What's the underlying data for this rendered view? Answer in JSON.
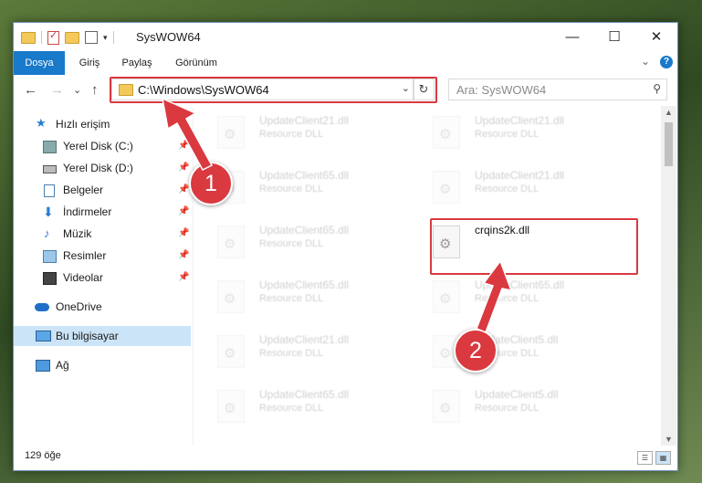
{
  "window": {
    "title": "SysWOW64",
    "controls": {
      "minimize": "—",
      "maximize": "☐",
      "close": "✕"
    }
  },
  "ribbon": {
    "tabs": [
      "Dosya",
      "Giriş",
      "Paylaş",
      "Görünüm"
    ],
    "accent_color": "#1979ca",
    "collapse_glyph": "⌄",
    "help_glyph": "?"
  },
  "navigation": {
    "back": "←",
    "forward": "→",
    "recent": "⌄",
    "up": "↑",
    "address": "C:\\Windows\\SysWOW64",
    "address_dropdown": "⌄",
    "refresh": "↻",
    "search_placeholder": "Ara: SysWOW64",
    "search_glyph": "⚲"
  },
  "sidebar": {
    "items": [
      {
        "label": "Hızlı erişim",
        "icon": "star-icon",
        "pinned": false
      },
      {
        "label": "Yerel Disk (C:)",
        "icon": "drive-icon",
        "pinned": true
      },
      {
        "label": "Yerel Disk (D:)",
        "icon": "drive-icon",
        "pinned": true
      },
      {
        "label": "Belgeler",
        "icon": "documents-icon",
        "pinned": true
      },
      {
        "label": "İndirmeler",
        "icon": "download-icon",
        "pinned": true
      },
      {
        "label": "Müzik",
        "icon": "music-icon",
        "pinned": true
      },
      {
        "label": "Resimler",
        "icon": "pictures-icon",
        "pinned": true
      },
      {
        "label": "Videolar",
        "icon": "videos-icon",
        "pinned": true
      },
      {
        "label": "OneDrive",
        "icon": "cloud-icon",
        "pinned": false
      },
      {
        "label": "Bu bilgisayar",
        "icon": "computer-icon",
        "pinned": false,
        "selected": true
      },
      {
        "label": "Ağ",
        "icon": "network-icon",
        "pinned": false
      }
    ],
    "pin_glyph": "📌"
  },
  "files": [
    {
      "name": "UpdateClient21.dll",
      "type": "Resource DLL"
    },
    {
      "name": "UpdateClient21.dll",
      "type": "Resource DLL"
    },
    {
      "name": "UpdateClient65.dll",
      "type": "Resource DLL"
    },
    {
      "name": "UpdateClient21.dll",
      "type": "Resource DLL"
    },
    {
      "name": "UpdateClient65.dll",
      "type": "Resource DLL"
    },
    {
      "name": "crqins2k.dll",
      "type": "",
      "highlighted": true
    },
    {
      "name": "UpdateClient65.dll",
      "type": "Resource DLL"
    },
    {
      "name": "UpdateClient65.dll",
      "type": "Resource DLL"
    },
    {
      "name": "UpdateClient21.dll",
      "type": "Resource DLL"
    },
    {
      "name": "UpdateClient5.dll",
      "type": "Resource DLL"
    },
    {
      "name": "UpdateClient65.dll",
      "type": "Resource DLL"
    },
    {
      "name": "UpdateClient5.dll",
      "type": "Resource DLL"
    }
  ],
  "status": {
    "item_count": "129 öğe"
  },
  "annotations": {
    "step1": "1",
    "step2": "2",
    "highlight_color": "#d9393f"
  }
}
